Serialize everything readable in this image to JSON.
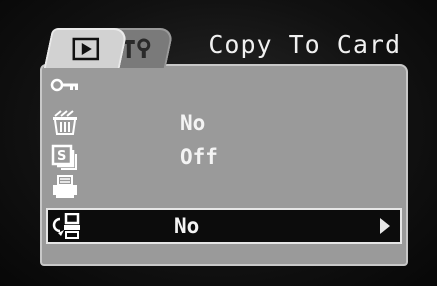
{
  "header": {
    "title": "Copy To Card",
    "tabs": [
      {
        "name": "playback",
        "icon": "playback-icon",
        "active": true
      },
      {
        "name": "setup",
        "icon": "setup-wrench-icon",
        "active": false
      }
    ]
  },
  "menu": {
    "items": [
      {
        "icon": "protect-key-icon",
        "value": ""
      },
      {
        "icon": "erase-trash-icon",
        "value": "No"
      },
      {
        "icon": "slideshow-icon",
        "value": "Off"
      },
      {
        "icon": "print-order-icon",
        "value": ""
      },
      {
        "icon": "copy-to-card-icon",
        "value": "No",
        "selected": true
      }
    ]
  },
  "colors": {
    "panel": "#9a9a9a",
    "selected_row": "#0c0c0c",
    "text": "#f4f4f4",
    "active_tab": "#d2d2d2",
    "inactive_tab": "#7a7a7a"
  }
}
